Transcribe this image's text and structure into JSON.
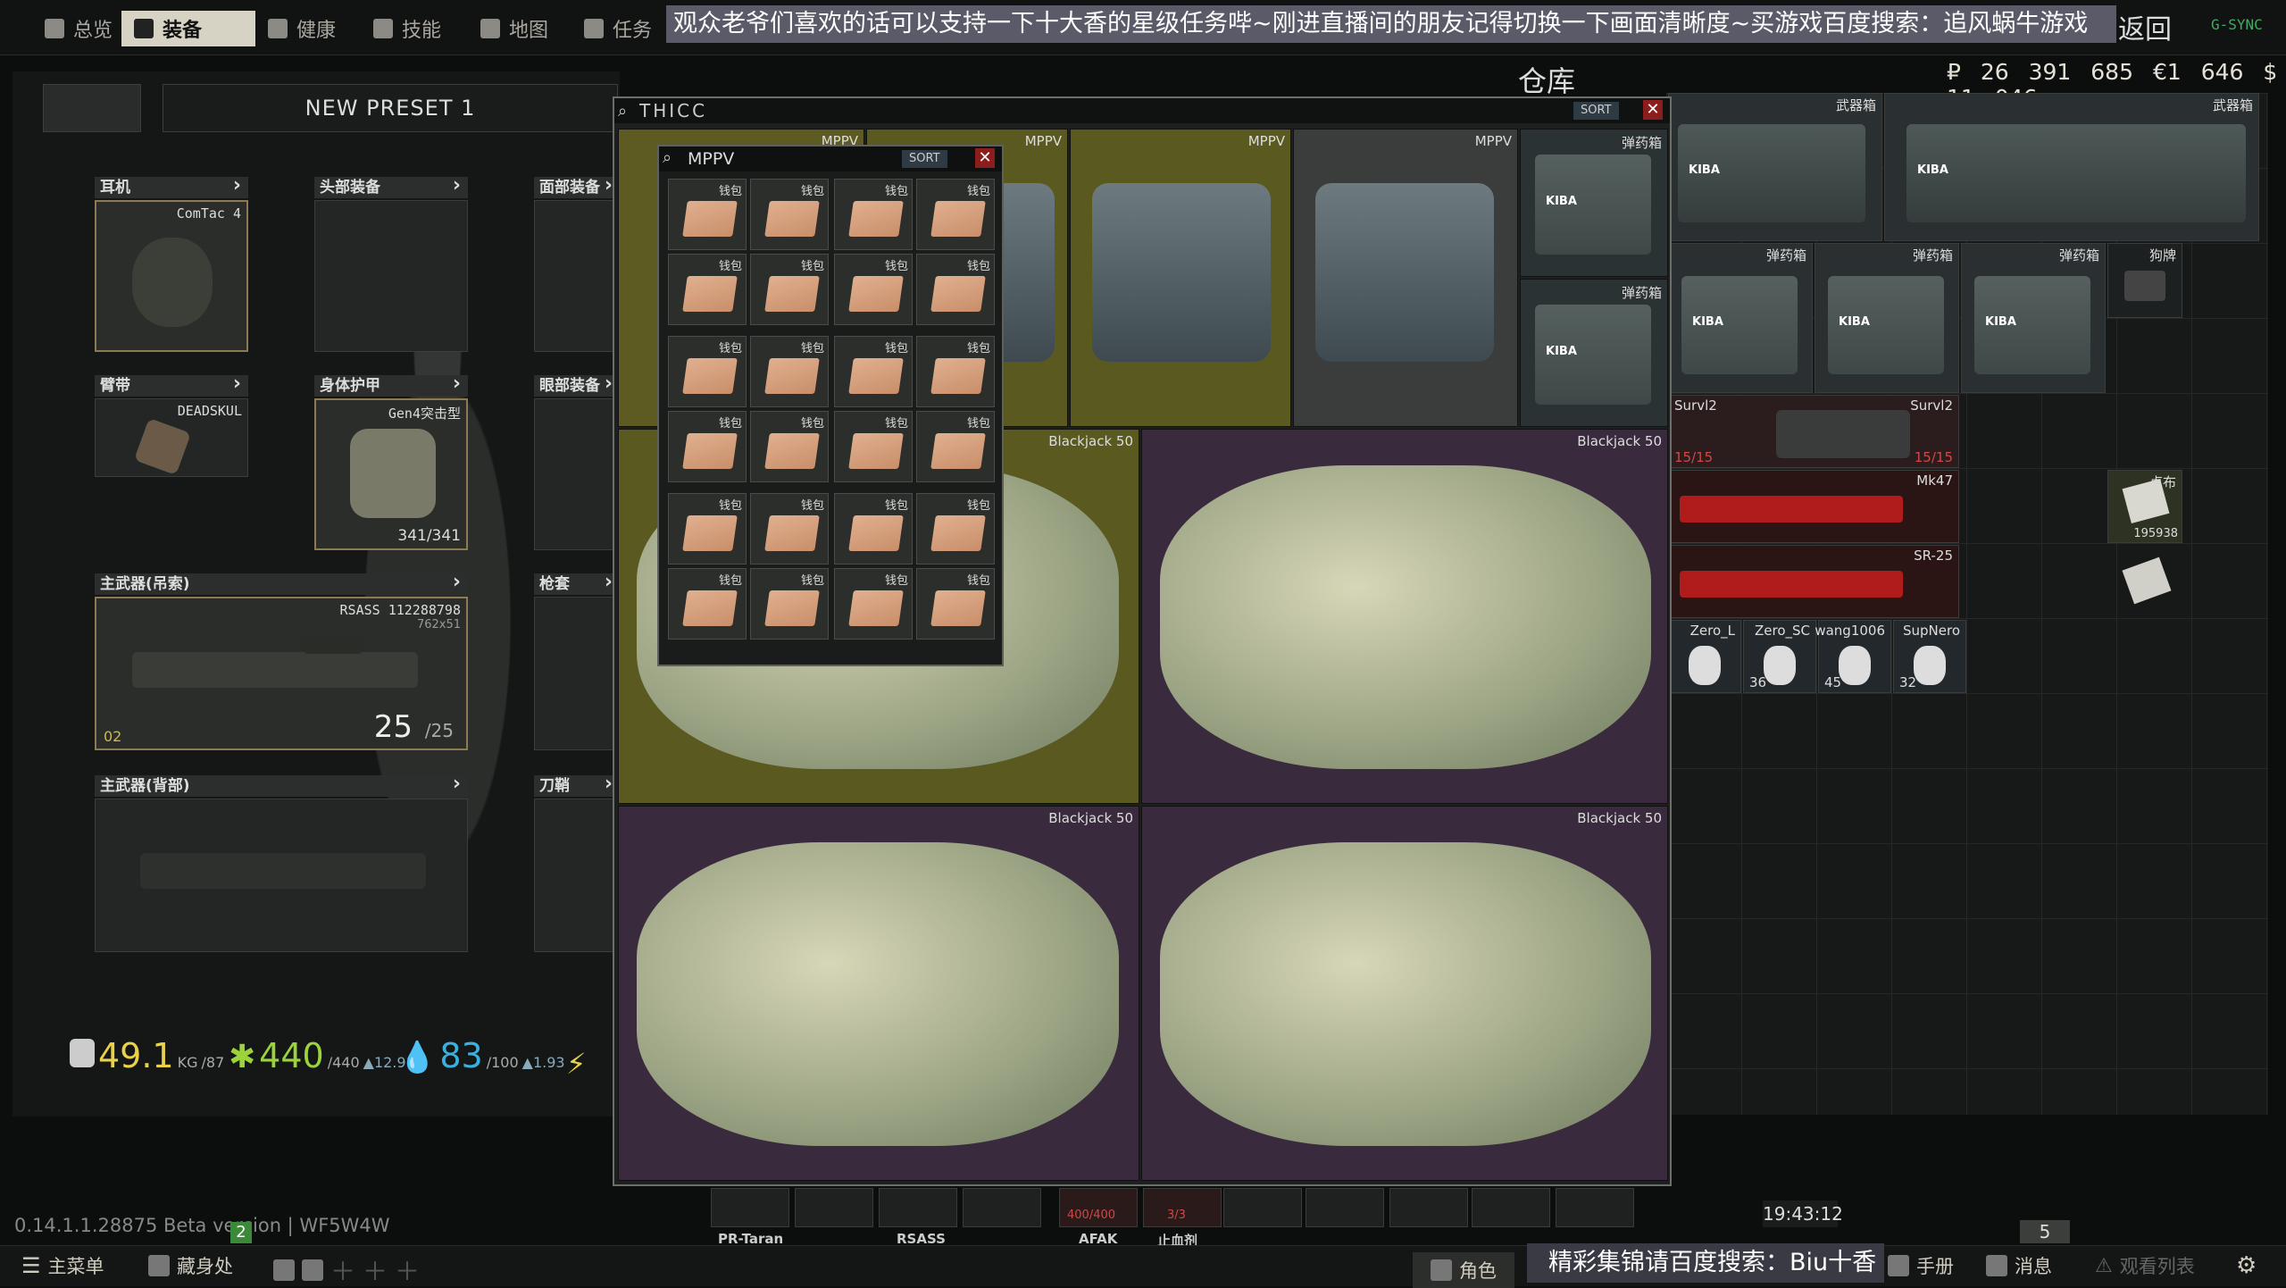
{
  "topbar": {
    "tabs": [
      {
        "label": "总览",
        "icon": "anchor-icon"
      },
      {
        "label": "装备",
        "icon": "gear-person-icon",
        "active": true
      },
      {
        "label": "健康",
        "icon": "health-icon"
      },
      {
        "label": "技能",
        "icon": "skills-icon"
      },
      {
        "label": "地图",
        "icon": "map-pin-icon"
      },
      {
        "label": "任务",
        "icon": "tasks-icon"
      }
    ],
    "banner": "观众老爷们喜欢的话可以支持一下十大香的星级任务哔~刚进直播间的朋友记得切换一下画面清晰度~买游戏百度搜索：追风蜗牛游戏",
    "back": "返回",
    "gsync": "G-SYNC"
  },
  "stash": {
    "title": "仓库",
    "currency": "₽ 26 391 685 €1 646 $ 11 046"
  },
  "preset": {
    "name": "NEW PRESET 1"
  },
  "slots": {
    "earpiece": {
      "label": "耳机",
      "item": "ComTac 4"
    },
    "headwear": {
      "label": "头部装备"
    },
    "faceCover": {
      "label": "面部装备"
    },
    "armband": {
      "label": "臂带",
      "item": "DEADSKUL"
    },
    "bodyArmor": {
      "label": "身体护甲",
      "item": "Gen4突击型",
      "durability": "341/341"
    },
    "eyewear": {
      "label": "眼部装备"
    },
    "onSling": {
      "label": "主武器(吊索)",
      "item": "RSASS 112288798",
      "caliber": "762x51",
      "ammo": "25",
      "ammoMax": "/25",
      "badge": "02"
    },
    "holster": {
      "label": "枪套"
    },
    "onBack": {
      "label": "主武器(背部)"
    },
    "scabbard": {
      "label": "刀鞘"
    }
  },
  "stats": {
    "weight": "49.1",
    "weightUnit": "KG",
    "weightMax": "/87",
    "health": "440",
    "healthMax": "/440",
    "healthRate": "▲12.91",
    "hydration": "83",
    "hydrationMax": "/100",
    "hydrationRate": "▲1.93"
  },
  "version": "0.14.1.1.28875 Beta version | WF5W4W",
  "thicc": {
    "title": "THICC",
    "sort": "SORT",
    "close": "✕",
    "cells": [
      {
        "label": "MPPV"
      },
      {
        "label": "MPPV"
      },
      {
        "label": "MPPV"
      },
      {
        "label": "MPPV"
      },
      {
        "label": "弹药箱"
      },
      {
        "label": "弹药箱"
      },
      {
        "label": "Blackjack 50"
      },
      {
        "label": "Blackjack 50"
      },
      {
        "label": "Blackjack 50"
      },
      {
        "label": "Blackjack 50"
      }
    ]
  },
  "mppv": {
    "title": "MPPV",
    "sort": "SORT",
    "close": "✕",
    "itemLabel": "钱包"
  },
  "stashItems": {
    "weaponCase": "武器箱",
    "ammoCase": "弹药箱",
    "dogtag": "狗牌",
    "surv12a": "Survl2",
    "surv12b": "Survl2",
    "surv12count": "15/15",
    "mk47": "Mk47",
    "sr25": "SR-25",
    "bandage": "卢布",
    "roubles": "195938",
    "mice": [
      {
        "label": "Zero_L",
        "count": ""
      },
      {
        "label": "Zero_SC",
        "count": "36"
      },
      {
        "label": "wang1006",
        "count": "45"
      },
      {
        "label": "SupNero",
        "count": "32"
      }
    ]
  },
  "quickSlots": {
    "labels": [
      "PR-Taran",
      "RSASS",
      "AFAK",
      "止血剂"
    ],
    "afakCount": "400/400",
    "hemoCount": "3/3"
  },
  "clock": "19:43:12",
  "bottombar": {
    "mainMenu": "主菜单",
    "hideout": "藏身处",
    "character": "角色",
    "promo": "精彩集锦请百度搜索：Biu十香",
    "handbook": "手册",
    "messages": "消息",
    "watchlist": "观看列表",
    "count2": "2",
    "count5": "5"
  }
}
